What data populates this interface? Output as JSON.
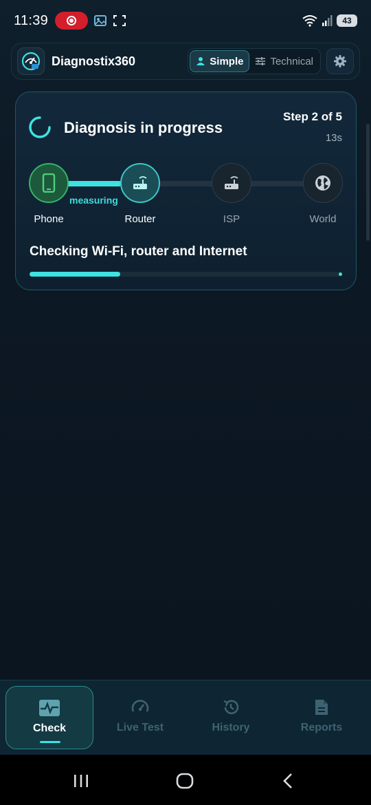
{
  "status_bar": {
    "time": "11:39",
    "battery": "43",
    "icons": [
      "record-icon",
      "gallery-icon",
      "screenshot-icon",
      "wifi-icon",
      "signal-icon",
      "battery-icon"
    ]
  },
  "app_bar": {
    "title": "Diagnostix360",
    "modes": [
      {
        "label": "Simple",
        "active": true,
        "icon": "person-icon"
      },
      {
        "label": "Technical",
        "active": false,
        "icon": "sliders-icon"
      }
    ],
    "settings_icon": "gear-icon"
  },
  "diagnosis": {
    "title": "Diagnosis in progress",
    "step": "Step 2 of 5",
    "elapsed": "13s",
    "nodes": [
      {
        "label": "Phone",
        "state": "done",
        "icon": "phone-icon"
      },
      {
        "label": "Router",
        "state": "active",
        "icon": "router-icon"
      },
      {
        "label": "ISP",
        "state": "pending",
        "icon": "router-icon"
      },
      {
        "label": "World",
        "state": "pending",
        "icon": "globe-icon"
      }
    ],
    "measuring_label": "measuring",
    "segment_progress": 0.7,
    "checking_text": "Checking Wi-Fi, router and Internet",
    "overall_progress": 0.29
  },
  "bottom_nav": {
    "items": [
      {
        "label": "Check",
        "active": true,
        "icon": "pulse-icon"
      },
      {
        "label": "Live Test",
        "active": false,
        "icon": "speedometer-icon"
      },
      {
        "label": "History",
        "active": false,
        "icon": "history-icon"
      },
      {
        "label": "Reports",
        "active": false,
        "icon": "document-icon"
      }
    ]
  },
  "colors": {
    "accent": "#3ee2e0",
    "done_green": "#36b369",
    "background": "#0b1622"
  }
}
